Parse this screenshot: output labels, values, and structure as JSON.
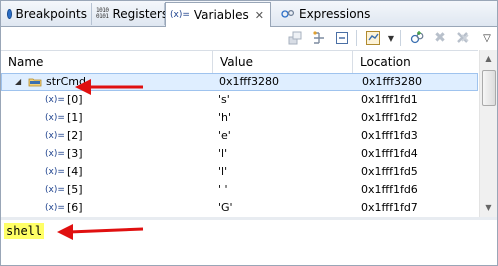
{
  "tabs": [
    {
      "label": "Breakpoints",
      "icon": "breakpoint-icon"
    },
    {
      "label": "Registers",
      "icon": "registers-icon"
    },
    {
      "label": "Variables",
      "icon": "variables-icon",
      "active": true
    },
    {
      "label": "Expressions",
      "icon": "expressions-icon"
    }
  ],
  "variables_tab_icon_text": "(x)=",
  "registers_icon_text": [
    "1010",
    "0101"
  ],
  "columns": {
    "name": "Name",
    "value": "Value",
    "location": "Location"
  },
  "rows": [
    {
      "name": "strCmd",
      "value": "0x1fff3280",
      "location": "0x1fff3280",
      "expanded": true,
      "selected": true
    },
    {
      "name": "[0]",
      "value": "'s'",
      "location": "0x1fff1fd1"
    },
    {
      "name": "[1]",
      "value": "'h'",
      "location": "0x1fff1fd2"
    },
    {
      "name": "[2]",
      "value": "'e'",
      "location": "0x1fff1fd3"
    },
    {
      "name": "[3]",
      "value": "'l'",
      "location": "0x1fff1fd4"
    },
    {
      "name": "[4]",
      "value": "'l'",
      "location": "0x1fff1fd5"
    },
    {
      "name": "[5]",
      "value": "' '",
      "location": "0x1fff1fd6"
    },
    {
      "name": "[6]",
      "value": "'G'",
      "location": "0x1fff1fd7"
    }
  ],
  "var_icon_text": "(x)=",
  "detail_text": "shell",
  "colors": {
    "arrow": "#e01010",
    "highlight": "#ffff66",
    "selection": "#dfeeff",
    "tab_border": "#99a6b7"
  }
}
